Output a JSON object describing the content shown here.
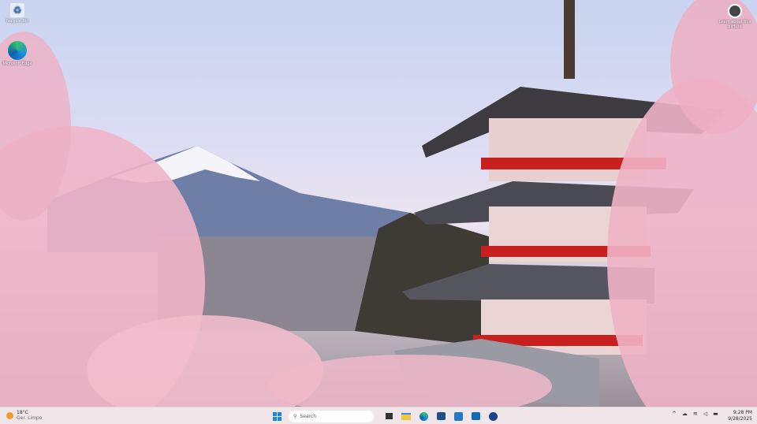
{
  "desktop": {
    "icons": [
      {
        "label": "Recycle Bin",
        "icon": "recycle-bin-icon"
      },
      {
        "label": "Microsoft Edge",
        "icon": "edge-icon"
      }
    ],
    "spotlight": {
      "label": "Learn about this picture",
      "icon": "camera-icon"
    }
  },
  "taskbar": {
    "weather": {
      "temp": "18°C",
      "condition": "Ger. Limpo"
    },
    "search_placeholder": "Search",
    "apps": [
      "task-view",
      "file-explorer",
      "edge",
      "store",
      "dell",
      "outlook",
      "security"
    ],
    "clock": {
      "time": "9:28 PM",
      "date": "9/28/2025"
    },
    "accent": "#0078d4"
  }
}
